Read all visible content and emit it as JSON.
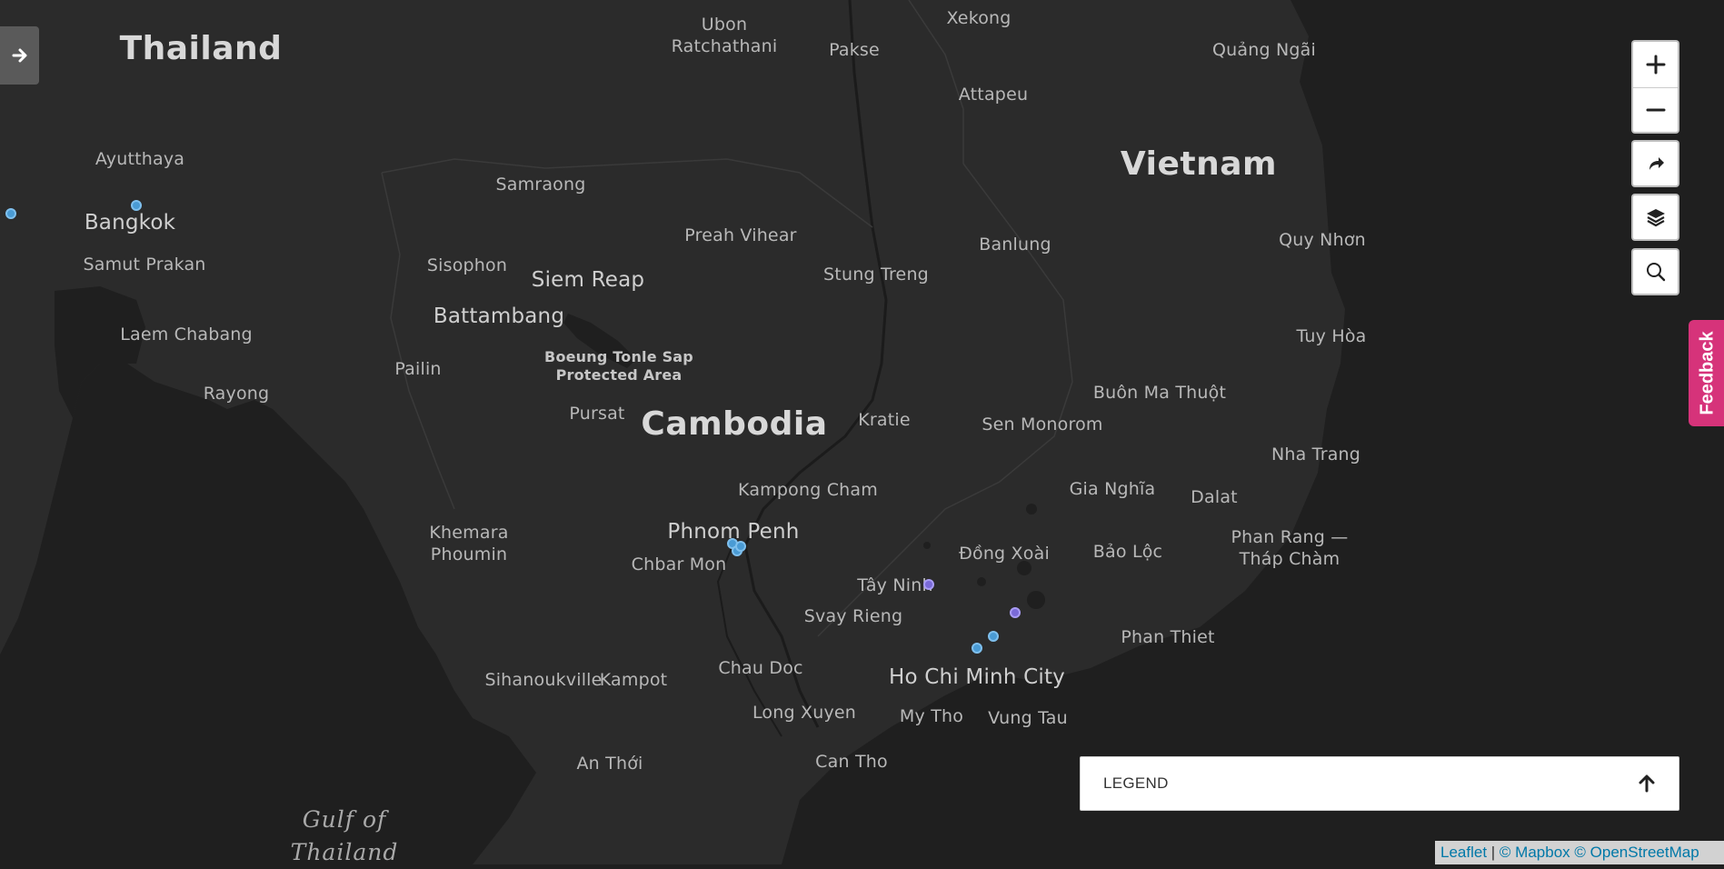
{
  "map": {
    "labels": {
      "countries": [
        "Thailand",
        "Cambodia",
        "Vietnam"
      ],
      "capitals": [
        "Bangkok",
        "Phnom Penh",
        "Ho Chi Minh City"
      ],
      "cities": [
        "Ubon Ratchathani",
        "Pakse",
        "Xekong",
        "Quảng Ngãi",
        "Attapeu",
        "Ayutthaya",
        "Samraong",
        "Preah Vihear",
        "Samut Prakan",
        "Sisophon",
        "Siem Reap",
        "Stung Treng",
        "Banlung",
        "Quy Nhơn",
        "Battambang",
        "Laem Chabang",
        "Pailin",
        "Tuy Hòa",
        "Rayong",
        "Pursat",
        "Kratie",
        "Buôn Ma Thuột",
        "Sen Monorom",
        "Nha Trang",
        "Kampong Cham",
        "Gia Nghĩa",
        "Dalat",
        "Khemara Phoumin",
        "Chbar Mon",
        "Đồng Xoài",
        "Bảo Lộc",
        "Phan Rang — Tháp Chàm",
        "Tây Ninh",
        "Svay Rieng",
        "Phan Thiet",
        "Chau Doc",
        "Sihanoukville",
        "Kampot",
        "Long Xuyen",
        "My Tho",
        "Vung Tau",
        "Can Tho",
        "An Thới"
      ],
      "protected_area": "Boeung Tonle Sap Protected Area",
      "water": "Gulf of Thailand"
    },
    "colors": {
      "land": "#2b2b2b",
      "water": "#1f1f1f",
      "marker_blue": "#4a9bd4",
      "marker_purple": "#7a6ad8",
      "feedback": "#d6337a"
    },
    "marker_colors": [
      "blue",
      "blue",
      "blue",
      "blue",
      "blue",
      "purple",
      "purple",
      "blue",
      "blue"
    ]
  },
  "controls": {
    "sidebar_toggle_icon": "arrow-right-icon",
    "zoom_in_icon": "plus-icon",
    "zoom_out_icon": "minus-icon",
    "share_icon": "share-arrow-icon",
    "layers_icon": "layers-icon",
    "search_icon": "search-icon",
    "feedback_label": "Feedback"
  },
  "legend": {
    "label": "LEGEND",
    "toggle_icon": "arrow-up-icon"
  },
  "attribution": {
    "leaflet": "Leaflet",
    "separator": " | ",
    "mapbox": "© Mapbox",
    "osm": "© OpenStreetMap"
  }
}
